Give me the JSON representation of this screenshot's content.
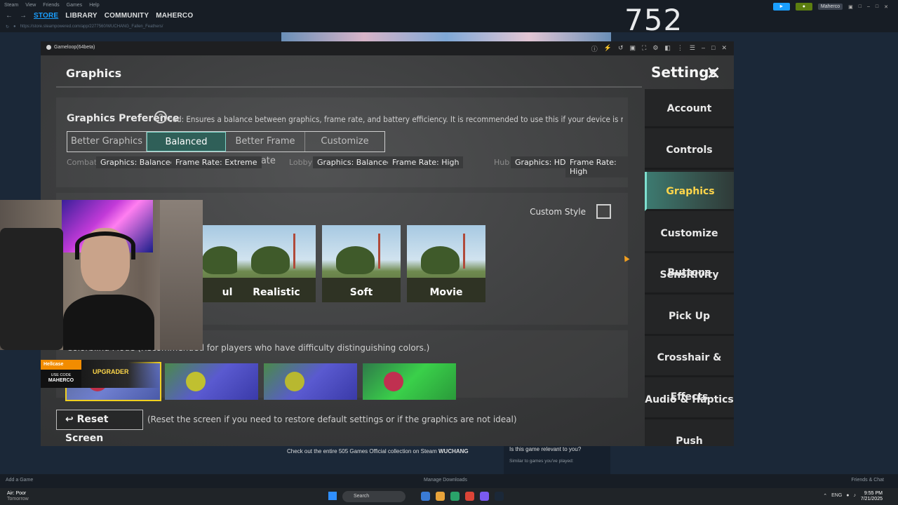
{
  "steam": {
    "menu": [
      "Steam",
      "View",
      "Friends",
      "Games",
      "Help"
    ],
    "tabs": [
      "STORE",
      "LIBRARY",
      "COMMUNITY",
      "MAHERCO"
    ],
    "url": "https://store.steampowered.com/app/2277560/WUCHANG_Fallen_Feathers/",
    "counter": "752",
    "username": "Maherco",
    "bottom_add": "Add a Game",
    "bottom_downloads": "Manage Downloads",
    "bottom_friends": "Friends & Chat",
    "store_text": "Check out the entire 505 Games Official collection on Steam",
    "store_brand": "WUCHANG",
    "relevant_q": "Is this game relevant to you?",
    "similar": "Similar to games you've played:"
  },
  "taskbar": {
    "weather": "Air: Poor",
    "weather_sub": "Tomorrow",
    "search_placeholder": "Search",
    "lang": "ENG",
    "time": "9:55 PM",
    "date": "7/21/2025"
  },
  "gameloop": {
    "title": "Gameloop(64beta)"
  },
  "settings": {
    "section_title": "Graphics",
    "title": "Settings",
    "preference_label": "Graphics Preference",
    "preference_help": "?",
    "preference_desc": "ced: Ensures a balance between graphics, frame rate, and battery efficiency. It is recommended to use this if your device is runni",
    "options": [
      "Better Graphics",
      "Balanced",
      "Better Frame Rate",
      "Customize"
    ],
    "selected_option": "Balanced",
    "combat_label": "Combat",
    "combat_graphics": "Graphics: Balanced",
    "combat_fps": "Frame Rate: Extreme",
    "lobby_label": "Lobby",
    "lobby_graphics": "Graphics: Balanced",
    "lobby_fps": "Frame Rate: High",
    "hub_label": "Hub",
    "hub_graphics": "Graphics: HD",
    "hub_fps": "Frame Rate: High",
    "custom_style": "Custom Style",
    "styles": [
      "ul",
      "Realistic",
      "Soft",
      "Movie"
    ],
    "colorblind_label": "Colorblind Mode (Recommended for players who have difficulty distinguishing colors.)",
    "reset_label": "Reset Screen",
    "reset_note": "(Reset the screen if you need to restore default settings or if the graphics are not ideal)"
  },
  "nav": [
    "Account",
    "Controls",
    "Graphics",
    "Customize Buttons",
    "Sensitivity",
    "Pick Up",
    "Crosshair & Effects",
    "Audio & Haptics",
    "Push Notifications"
  ],
  "nav_active": "Graphics",
  "promo": {
    "brand": "Hellcase",
    "use_code": "USE CODE",
    "code": "MAHERCO",
    "upgrader": "UPGRADER"
  },
  "colors": {
    "accent": "#7fd3c8",
    "active_nav_text": "#ffd54a",
    "steam_blue": "#1a9fff"
  }
}
